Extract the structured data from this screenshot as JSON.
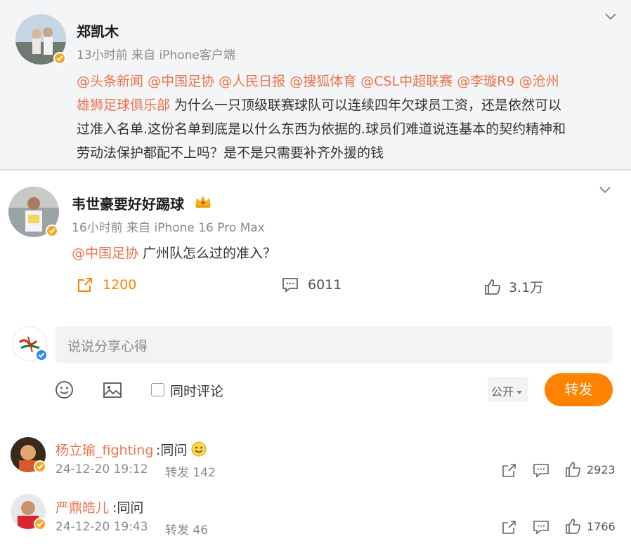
{
  "original_post": {
    "author": "郑凯木",
    "meta": "13小时前 来自 iPhone客户端",
    "mentions": [
      "@头条新闻",
      "@中国足协",
      "@人民日报",
      "@搜狐体育",
      "@CSL中超联赛",
      "@李璇R9",
      "@沧州"
    ],
    "mention_line2": "雄狮足球俱乐部",
    "text_line2": " 为什么一只顶级联赛球队可以连续四年欠球员工资，还是依然可以",
    "text_line3": "过准入名单.这份名单到底是以什么东西为依据的.球员们难道说连基本的契约精神和",
    "text_line4": "劳动法保护都配不上吗？是不是只需要补齐外援的钱"
  },
  "repost": {
    "author": "韦世豪要好好踢球",
    "meta": "16小时前 来自 iPhone 16 Pro Max",
    "mention": "@中国足协",
    "text": " 广州队怎么过的准入？",
    "actions": {
      "repost_count": "1200",
      "comment_count": "6011",
      "like_count": "3.1万"
    }
  },
  "composer": {
    "placeholder": "说说分享心得",
    "checkbox_label": "同时评论",
    "visibility": "公开",
    "submit_label": "转发"
  },
  "comments": [
    {
      "name": "杨立瑜_fighting",
      "text": ":同问",
      "emoji": "smile",
      "date": "24-12-20 19:12",
      "repost_label": "转发 142",
      "likes": "2923"
    },
    {
      "name": "严鼎皓儿",
      "text": ":同问",
      "date": "24-12-20 19:43",
      "repost_label": "转发 46",
      "likes": "1766"
    }
  ],
  "colors": {
    "accent": "#ff8200",
    "mention": "#eb7350",
    "verified": "#f6a623"
  }
}
